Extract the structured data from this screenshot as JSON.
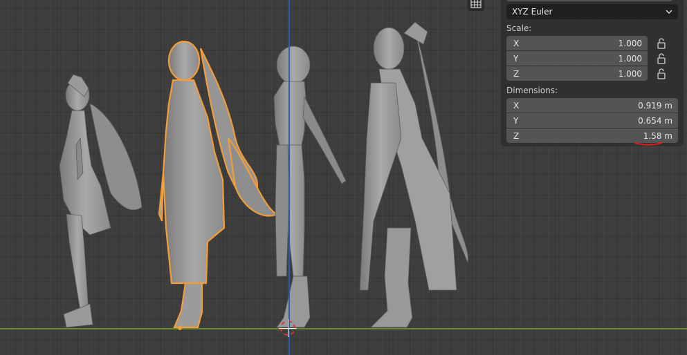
{
  "viewport": {
    "grid_toggle_icon": "grid-icon",
    "axis_colors": {
      "z": "#2a5fa8",
      "y": "#6a8e2b"
    },
    "selection_outline_color": "#f39c3a"
  },
  "panel": {
    "rotation_mode": "XYZ Euler",
    "scale_label": "Scale:",
    "scale": [
      {
        "axis": "X",
        "value": "1.000"
      },
      {
        "axis": "Y",
        "value": "1.000"
      },
      {
        "axis": "Z",
        "value": "1.000"
      }
    ],
    "dimensions_label": "Dimensions:",
    "dimensions": [
      {
        "axis": "X",
        "value": "0.919 m"
      },
      {
        "axis": "Y",
        "value": "0.654 m"
      },
      {
        "axis": "Z",
        "value": "1.58 m"
      }
    ],
    "annotation_color": "#e01b1b"
  }
}
